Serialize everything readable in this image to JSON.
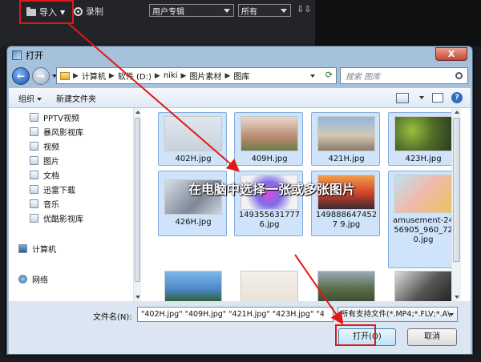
{
  "app": {
    "import_label": "导入",
    "record_label": "录制",
    "filter1": "用户专辑",
    "filter2": "所有",
    "sort_symbol": "⇩⇩"
  },
  "dialog": {
    "title": "打开",
    "close_label": "X",
    "breadcrumb": [
      "计算机",
      "软件 (D:)",
      "niki",
      "图片素材",
      "图库"
    ],
    "search_placeholder": "搜索 图库",
    "toolbar": {
      "organize": "组织",
      "new_folder": "新建文件夹"
    },
    "nav": [
      {
        "label": "PPTV视频"
      },
      {
        "label": "暴风影视库"
      },
      {
        "label": "视频"
      },
      {
        "label": "图片"
      },
      {
        "label": "文档"
      },
      {
        "label": "迅雷下载"
      },
      {
        "label": "音乐"
      },
      {
        "label": "优酷影视库"
      }
    ],
    "nav_computer": "计算机",
    "nav_network": "网络",
    "files": [
      {
        "name": "402H.jpg",
        "selected": true
      },
      {
        "name": "409H.jpg",
        "selected": true
      },
      {
        "name": "421H.jpg",
        "selected": true
      },
      {
        "name": "423H.jpg",
        "selected": true
      },
      {
        "name": "426H.jpg",
        "selected": true
      },
      {
        "name": "1493556317776.jpg",
        "selected": true
      },
      {
        "name": "1498886474527 9.jpg",
        "selected": true
      },
      {
        "name": "amusement-2456905_960_720.jpg",
        "selected": true
      },
      {
        "name": "",
        "selected": false
      },
      {
        "name": "",
        "selected": false
      },
      {
        "name": "",
        "selected": false
      },
      {
        "name": "",
        "selected": false
      }
    ],
    "filename_label": "文件名(N):",
    "filename_value": "\"402H.jpg\" \"409H.jpg\" \"421H.jpg\" \"423H.jpg\" \"4",
    "filetype_value": "所有支持文件(*.MP4;*.FLV;*.A\\",
    "open_label": "打开(O)",
    "cancel_label": "取消"
  },
  "annotation": "在电脑中选择一张或多张图片",
  "colors": {
    "highlight": "#e01818",
    "selection": "#cfe4fa"
  }
}
